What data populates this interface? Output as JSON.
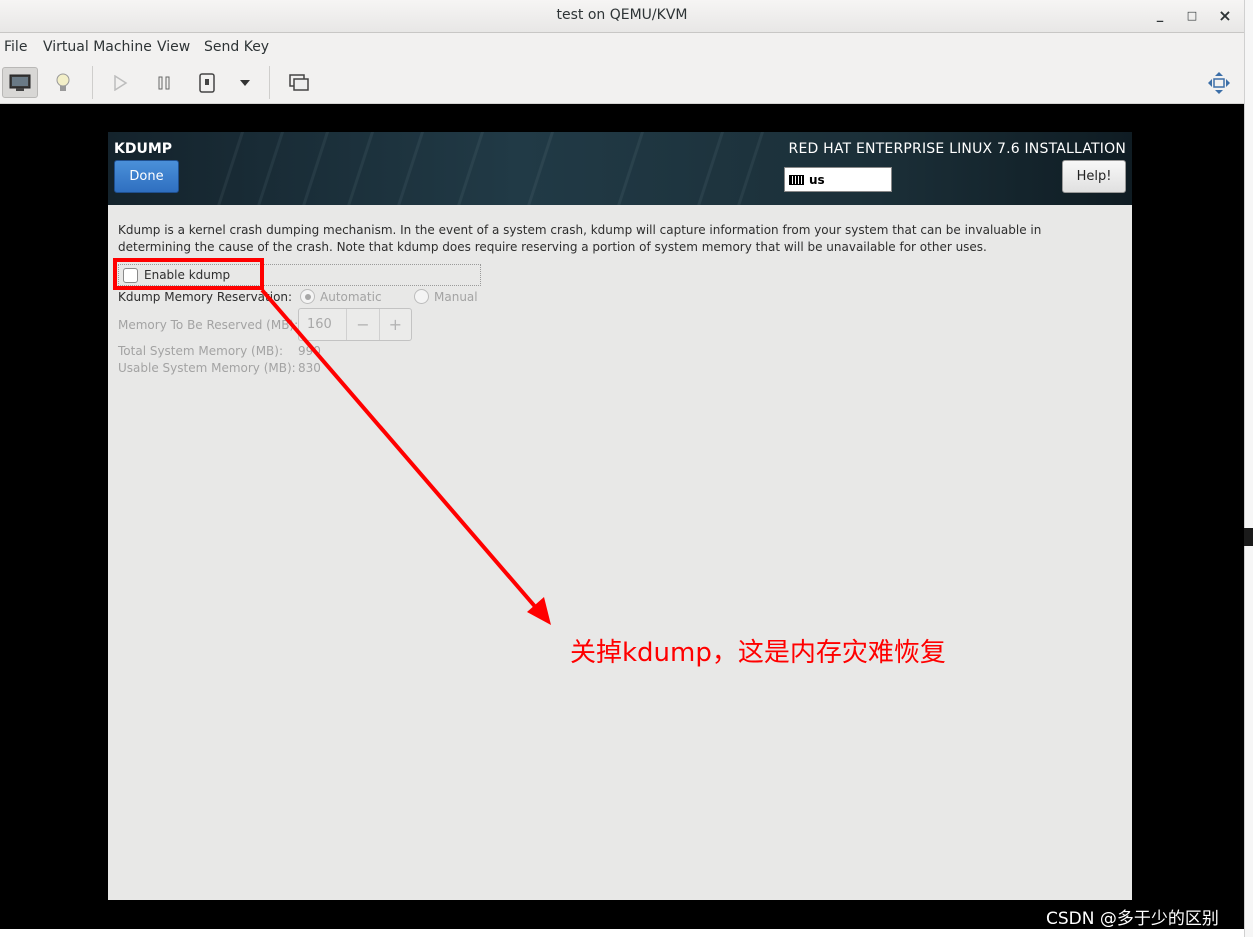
{
  "window": {
    "title": "test on QEMU/KVM",
    "minimize": "_",
    "maximize": "□",
    "close": "×"
  },
  "menubar": [
    "File",
    "Virtual Machine",
    "View",
    "Send Key"
  ],
  "toolbar": {
    "icons": [
      "console-icon",
      "details-lightbulb-icon",
      "run-icon",
      "pause-icon",
      "shutdown-icon",
      "dropdown-icon",
      "snapshot-icon",
      "fullscreen-icon"
    ]
  },
  "installer": {
    "screen_title": "KDUMP",
    "done_label": "Done",
    "product_title": "RED HAT ENTERPRISE LINUX 7.6 INSTALLATION",
    "keyboard_layout": "us",
    "help_label": "Help!",
    "description": "Kdump is a kernel crash dumping mechanism. In the event of a system crash, kdump will capture information from your system that can be invaluable in determining the cause of the crash. Note that kdump does require reserving a portion of system memory that will be unavailable for other uses.",
    "enable_label": "Enable kdump",
    "enable_checked": false,
    "reservation_label": "Kdump Memory Reservation:",
    "option_automatic": "Automatic",
    "option_manual": "Manual",
    "selected_option": "Automatic",
    "memory_reserved_label": "Memory To Be Reserved (MB):",
    "memory_reserved_value": "160",
    "minus": "−",
    "plus": "+",
    "total_memory_label": "Total System Memory (MB):",
    "total_memory_value": "990",
    "usable_memory_label": "Usable System Memory (MB):",
    "usable_memory_value": "830"
  },
  "annotation": {
    "text": "关掉kdump，这是内存灾难恢复",
    "color": "#ff0000"
  },
  "watermark": "CSDN @多于少的区别"
}
